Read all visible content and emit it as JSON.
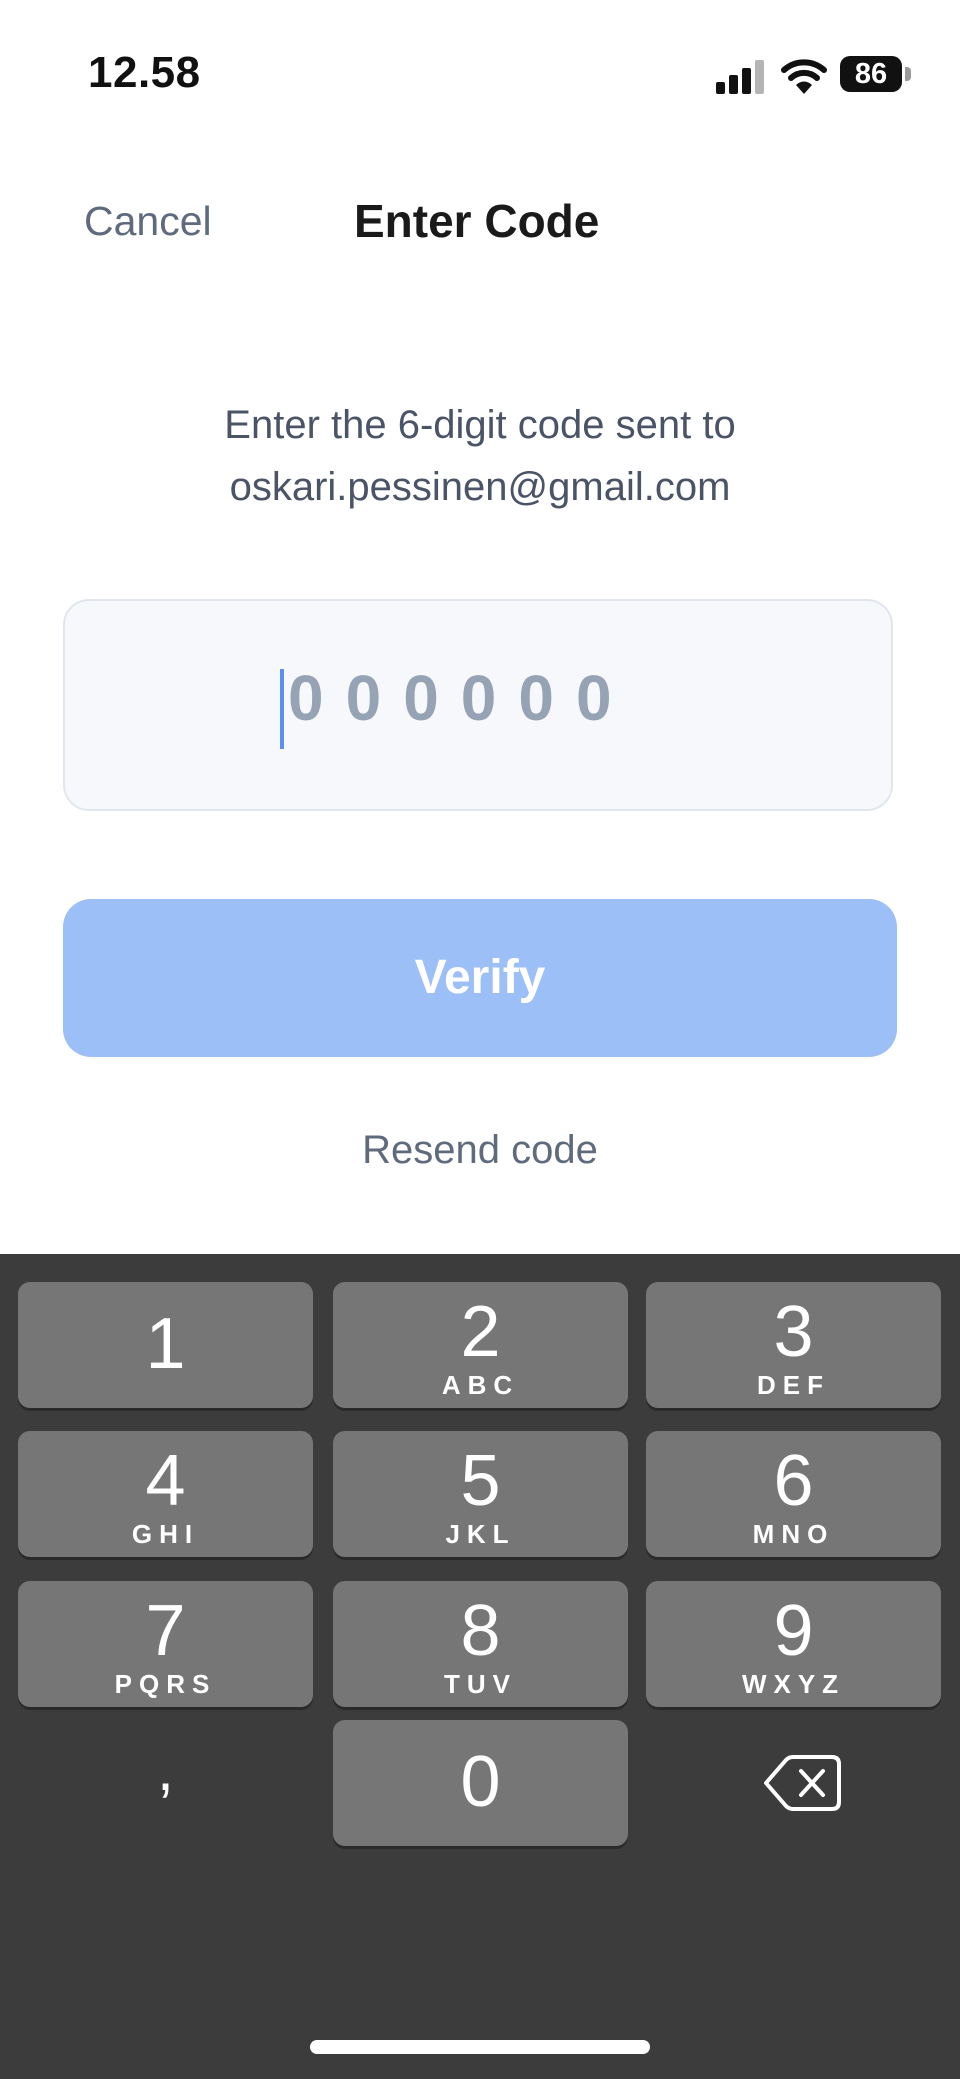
{
  "status_bar": {
    "time": "12.58",
    "battery": "86",
    "icons": [
      "signal-icon",
      "wifi-icon",
      "battery-icon"
    ]
  },
  "header": {
    "cancel_label": "Cancel",
    "title": "Enter Code"
  },
  "instruction": {
    "line1": "Enter the 6-digit code sent to",
    "line2": "oskari.pessinen@gmail.com"
  },
  "code_input": {
    "placeholder": "000000",
    "value": ""
  },
  "verify_label": "Verify",
  "resend_label": "Resend code",
  "keypad": {
    "keys": [
      {
        "digit": "1",
        "letters": ""
      },
      {
        "digit": "2",
        "letters": "ABC"
      },
      {
        "digit": "3",
        "letters": "DEF"
      },
      {
        "digit": "4",
        "letters": "GHI"
      },
      {
        "digit": "5",
        "letters": "JKL"
      },
      {
        "digit": "6",
        "letters": "MNO"
      },
      {
        "digit": "7",
        "letters": "PQRS"
      },
      {
        "digit": "8",
        "letters": "TUV"
      },
      {
        "digit": "9",
        "letters": "WXYZ"
      },
      {
        "digit": "0",
        "letters": ""
      }
    ],
    "comma": ",",
    "delete_icon": "backspace-icon"
  },
  "colors": {
    "accent": "#9dbff7",
    "caret": "#5b8ff0",
    "keyboard_bg": "#3c3c3c",
    "key_bg": "#767676"
  }
}
